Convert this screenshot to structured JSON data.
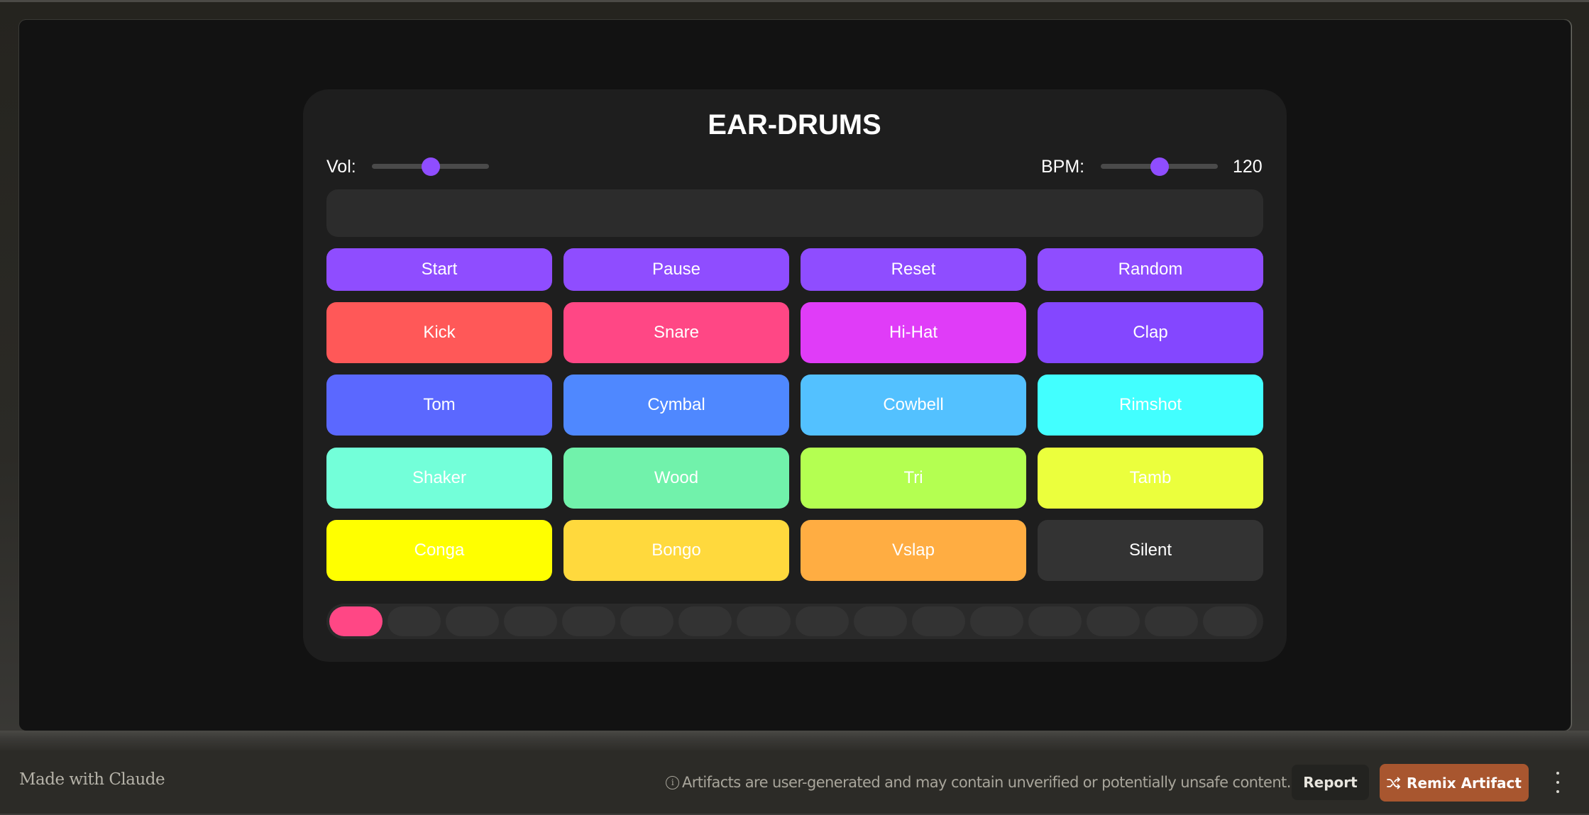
{
  "app": {
    "title": "EAR-DRUMS",
    "volume": {
      "label": "Vol:",
      "value": 0.5
    },
    "bpm": {
      "label": "BPM:",
      "value": 120,
      "min": 60,
      "max": 180,
      "display": "120"
    },
    "display_text": "",
    "controls": [
      {
        "label": "Start",
        "color": "#8f4dff"
      },
      {
        "label": "Pause",
        "color": "#8f4dff"
      },
      {
        "label": "Reset",
        "color": "#8f4dff"
      },
      {
        "label": "Random",
        "color": "#8f4dff"
      }
    ],
    "pads": [
      {
        "label": "Kick",
        "color": "#ff5858"
      },
      {
        "label": "Snare",
        "color": "#ff4785"
      },
      {
        "label": "Hi-Hat",
        "color": "#e03cf8"
      },
      {
        "label": "Clap",
        "color": "#8447ff"
      },
      {
        "label": "Tom",
        "color": "#5b68ff"
      },
      {
        "label": "Cymbal",
        "color": "#4f88ff"
      },
      {
        "label": "Cowbell",
        "color": "#53c1ff"
      },
      {
        "label": "Rimshot",
        "color": "#42ffff"
      },
      {
        "label": "Shaker",
        "color": "#73ffd9"
      },
      {
        "label": "Wood",
        "color": "#71f2ab"
      },
      {
        "label": "Tri",
        "color": "#b4ff51"
      },
      {
        "label": "Tamb",
        "color": "#ebff3d"
      },
      {
        "label": "Conga",
        "color": "#ffff00"
      },
      {
        "label": "Bongo",
        "color": "#ffd93d"
      },
      {
        "label": "Vslap",
        "color": "#ffad42"
      },
      {
        "label": "Silent",
        "color": "#333333"
      }
    ],
    "sequencer": {
      "step_count": 16,
      "steps": [
        {
          "active": true,
          "color": "#ff4785"
        },
        {
          "active": false
        },
        {
          "active": false
        },
        {
          "active": false
        },
        {
          "active": false
        },
        {
          "active": false
        },
        {
          "active": false
        },
        {
          "active": false
        },
        {
          "active": false
        },
        {
          "active": false
        },
        {
          "active": false
        },
        {
          "active": false
        },
        {
          "active": false
        },
        {
          "active": false
        },
        {
          "active": false
        },
        {
          "active": false
        }
      ],
      "inactive_color": "#333333"
    }
  },
  "footer": {
    "made_with": "Made with Claude",
    "notice_icon": "info-icon",
    "notice": "Artifacts are user-generated and may contain unverified or potentially unsafe content.",
    "report_label": "Report",
    "remix_icon": "shuffle-icon",
    "remix_label": "Remix Artifact",
    "more_icon": "kebab-menu-icon",
    "accent": "#a8562f"
  }
}
